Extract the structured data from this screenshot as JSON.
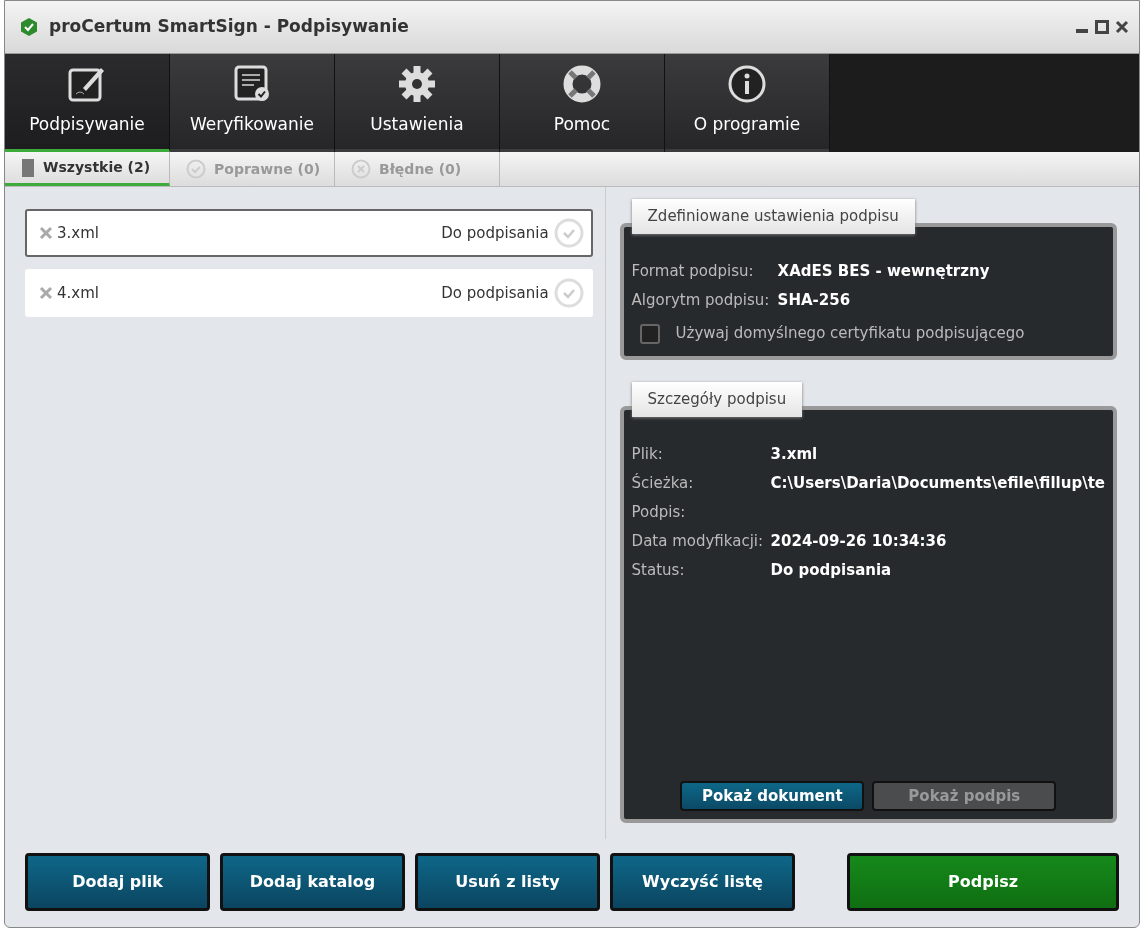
{
  "window": {
    "title": "proCertum SmartSign - Podpisywanie"
  },
  "toolbar": [
    {
      "label": "Podpisywanie",
      "kind": "sign",
      "selected": true
    },
    {
      "label": "Weryfikowanie",
      "kind": "verify",
      "selected": false
    },
    {
      "label": "Ustawienia",
      "kind": "settings",
      "selected": false
    },
    {
      "label": "Pomoc",
      "kind": "help",
      "selected": false
    },
    {
      "label": "O programie",
      "kind": "info",
      "selected": false
    }
  ],
  "filter_tabs": [
    {
      "label": "Wszystkie (2)",
      "kind": "all",
      "selected": true
    },
    {
      "label": "Poprawne (0)",
      "kind": "valid",
      "selected": false
    },
    {
      "label": "Błędne (0)",
      "kind": "invalid",
      "selected": false
    }
  ],
  "files": [
    {
      "name": "3.xml",
      "status": "Do podpisania",
      "selected": true
    },
    {
      "name": "4.xml",
      "status": "Do podpisania",
      "selected": false
    }
  ],
  "settings_panel": {
    "title": "Zdefiniowane ustawienia podpisu",
    "fields": [
      {
        "label": "Format podpisu:",
        "value": "XAdES BES - wewnętrzny"
      },
      {
        "label": "Algorytm podpisu:",
        "value": "SHA-256"
      }
    ],
    "checkbox": {
      "label": "Używaj domyślnego certyfikatu podpisującego",
      "checked": false
    }
  },
  "details_panel": {
    "title": "Szczegóły podpisu",
    "fields": [
      {
        "label": "Plik:",
        "value": "3.xml"
      },
      {
        "label": "Ścieżka:",
        "value": "C:\\Users\\Daria\\Documents\\efile\\fillup\\te"
      },
      {
        "label": "Podpis:"
      },
      {
        "label": "Data modyfikacji:",
        "value": "2024-09-26 10:34:36"
      },
      {
        "label": "Status:",
        "value": "Do podpisania"
      }
    ],
    "buttons": [
      {
        "label": "Pokaż dokument",
        "disabled": false
      },
      {
        "label": "Pokaż podpis",
        "disabled": true
      }
    ]
  },
  "bottom_buttons": [
    {
      "label": "Dodaj plik",
      "kind": "normal"
    },
    {
      "label": "Dodaj katalog",
      "kind": "normal"
    },
    {
      "label": "Usuń z listy",
      "kind": "normal"
    },
    {
      "label": "Wyczyść listę",
      "kind": "normal"
    },
    {
      "label": "Podpisz",
      "kind": "primary"
    }
  ]
}
